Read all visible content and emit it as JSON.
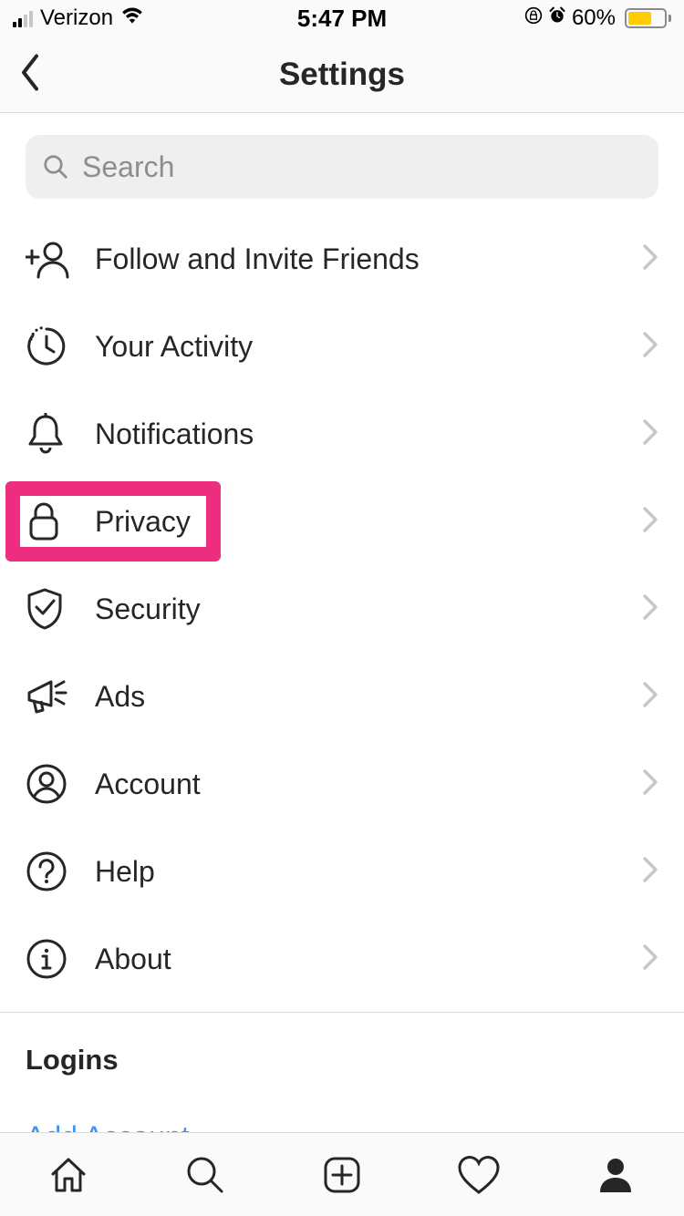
{
  "status": {
    "carrier": "Verizon",
    "time": "5:47 PM",
    "battery_pct": "60%"
  },
  "nav": {
    "title": "Settings"
  },
  "search": {
    "placeholder": "Search"
  },
  "menu": [
    {
      "icon": "add-user-icon",
      "label": "Follow and Invite Friends"
    },
    {
      "icon": "clock-icon",
      "label": "Your Activity"
    },
    {
      "icon": "bell-icon",
      "label": "Notifications"
    },
    {
      "icon": "lock-icon",
      "label": "Privacy",
      "highlighted": true
    },
    {
      "icon": "shield-check-icon",
      "label": "Security"
    },
    {
      "icon": "megaphone-icon",
      "label": "Ads"
    },
    {
      "icon": "user-circle-icon",
      "label": "Account"
    },
    {
      "icon": "help-circle-icon",
      "label": "Help"
    },
    {
      "icon": "info-icon",
      "label": "About"
    }
  ],
  "section": {
    "title": "Logins"
  },
  "actions": {
    "add_account": "Add Account"
  },
  "highlight_color": "#ed2e7e"
}
